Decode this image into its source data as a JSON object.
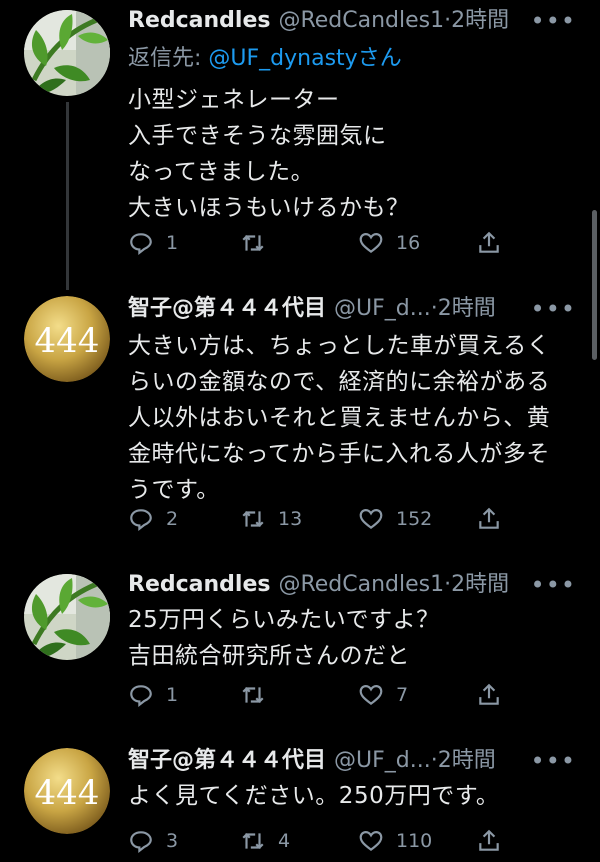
{
  "tweets": [
    {
      "display_name": "Redcandles",
      "handle": "@RedCandles1",
      "separator": "·",
      "time": "2時間",
      "more": "•••",
      "reply_label": "返信先: ",
      "reply_mention": "@UF_dynasty",
      "reply_suffix": "さん",
      "text": "小型ジェネレーター\n入手できそうな雰囲気に\nなってきました。\n大きいほうもいけるかも？",
      "replies": "1",
      "retweets": "",
      "likes": "16"
    },
    {
      "display_name": "智子@第４４４代目",
      "handle": "@UF_d...",
      "separator": "·",
      "time": "2時間",
      "more": "•••",
      "text": "大きい方は、ちょっとした車が買えるく\nらいの金額なので、経済的に余裕がある\n人以外はおいそれと買えませんから、黄\n金時代になってから手に入れる人が多そ\nうです。",
      "replies": "2",
      "retweets": "13",
      "likes": "152"
    },
    {
      "display_name": "Redcandles",
      "handle": "@RedCandles1",
      "separator": "·",
      "time": "2時間",
      "more": "•••",
      "text": "25万円くらいみたいですよ？\n吉田統合研究所さんのだと",
      "replies": "1",
      "retweets": "",
      "likes": "7"
    },
    {
      "display_name": "智子@第４４４代目",
      "handle": "@UF_d...",
      "separator": "·",
      "time": "2時間",
      "more": "•••",
      "text": "よく見てください。250万円です。",
      "replies": "3",
      "retweets": "4",
      "likes": "110"
    }
  ],
  "avatar_text": "444",
  "icons": {
    "reply": "reply-icon",
    "retweet": "retweet-icon",
    "like": "heart-icon",
    "share": "share-icon",
    "more": "more-icon"
  },
  "colors": {
    "background": "#000000",
    "text": "#e7e9ea",
    "secondary": "#8b98a5",
    "link": "#1d9bf0",
    "gold": "#c9a544"
  }
}
